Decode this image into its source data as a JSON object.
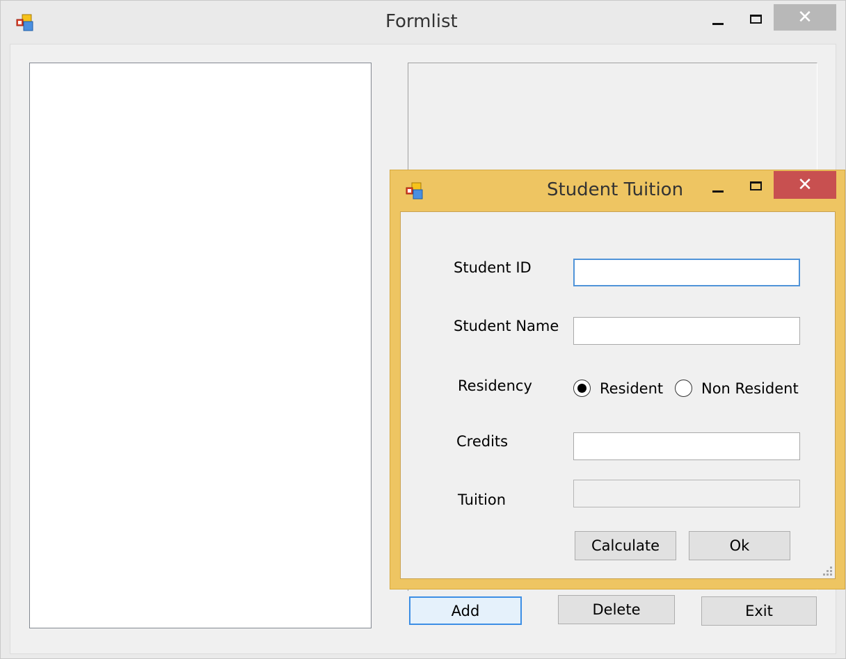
{
  "main_window": {
    "title": "Formlist",
    "buttons": {
      "add": "Add",
      "delete": "Delete",
      "exit": "Exit"
    }
  },
  "dialog": {
    "title": "Student Tuition",
    "labels": {
      "student_id": "Student ID",
      "student_name": "Student Name",
      "residency": "Residency",
      "credits": "Credits",
      "tuition": "Tuition"
    },
    "fields": {
      "student_id_value": "",
      "student_name_value": "",
      "credits_value": "",
      "tuition_value": ""
    },
    "residency_options": [
      {
        "label": "Resident",
        "selected": true
      },
      {
        "label": "Non Resident",
        "selected": false
      }
    ],
    "buttons": {
      "calculate": "Calculate",
      "ok": "Ok"
    }
  },
  "icons": {
    "app_icon": "app-icon",
    "minimize": "minimize-icon",
    "maximize": "maximize-icon",
    "close": "close-icon"
  },
  "colors": {
    "dialog_frame": "#eec562",
    "close_button_active": "#c85050",
    "close_button_inactive": "#b8b8b8",
    "focus_border": "#3c8ee5"
  }
}
